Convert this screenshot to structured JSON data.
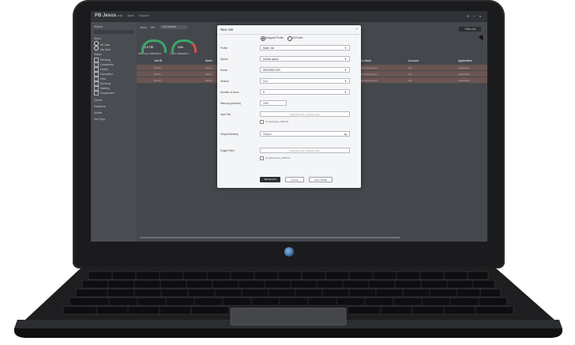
{
  "app": {
    "title": "PB Jesus",
    "nav": [
      "Jobs",
      "Alerts",
      "Reports"
    ],
    "top_icons": "⚙ ≡ ●"
  },
  "sidebar": {
    "search_label": "Search",
    "view_label": "Show",
    "radio_options": [
      "All Jobs",
      "My Jobs"
    ],
    "status_label": "Status",
    "statuses": [
      "Pending",
      "Completed",
      "Failed",
      "Cancelled",
      "Held",
      "Running",
      "Waiting",
      "Suspended"
    ],
    "groups": [
      "Queue",
      "Partitions",
      "Nodes",
      "Job Type"
    ]
  },
  "toolbar": {
    "show_label": "Show",
    "count": "100",
    "filter_text": "Job Details",
    "new_job_label": "+ New Job"
  },
  "gauges": [
    {
      "label": "Memory Utilization",
      "value": "2.9 TiB"
    },
    {
      "label": "Core Utilization",
      "value": "34%"
    }
  ],
  "table": {
    "columns": [
      "Job ID",
      "Name",
      "User Name",
      "Account",
      "Application"
    ],
    "rows": [
      [
        "Job ID",
        "Name",
        "job@example.com",
        "Acc",
        "Application"
      ],
      [
        "Job ID",
        "Name",
        "job@example.com",
        "Acc",
        "Application"
      ],
      [
        "Job ID",
        "Name",
        "job@example.com",
        "Acc",
        "Application"
      ]
    ]
  },
  "modal": {
    "title": "New Job",
    "close": "×",
    "radio_options": [
      "Assigned Profile",
      "All Profile"
    ],
    "fields": {
      "profile": {
        "label": "Profile",
        "value": "Batch Job"
      },
      "queue": {
        "label": "Queue",
        "value": "Default queue"
      },
      "server": {
        "label": "Server",
        "value": "DRIVERS-SVR"
      },
      "version": {
        "label": "Version",
        "value": "11.0"
      },
      "cores": {
        "label": "Number of cores",
        "value": "8"
      },
      "memory": {
        "label": "Memory (mb/core)",
        "value": "2000"
      },
      "input": {
        "label": "Input File",
        "drop_text": "Drag files here or Browse files",
        "path": "/tmp/job/input_2000.dat"
      },
      "output": {
        "label": "Output directory",
        "value": "/Output"
      },
      "engine": {
        "label": "Engine Files",
        "drop_text": "Drag files here or Browse files",
        "path": "/tmp/job/engine_2000.dat"
      }
    },
    "buttons": {
      "submit": "Submit Job",
      "cancel": "Cancel",
      "save": "Save Profile"
    }
  }
}
